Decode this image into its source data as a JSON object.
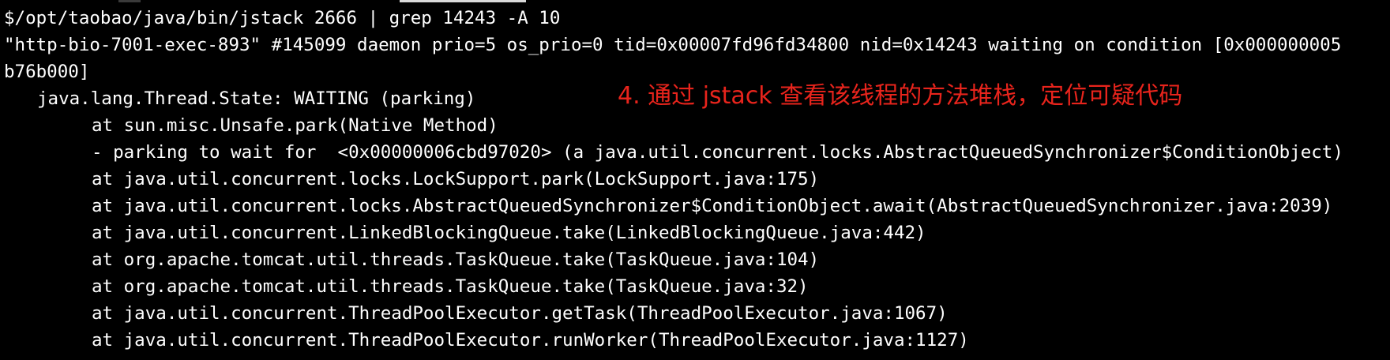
{
  "terminal": {
    "lines": [
      "$/opt/taobao/java/bin/jstack 2666 | grep 14243 -A 10",
      "\"http-bio-7001-exec-893\" #145099 daemon prio=5 os_prio=0 tid=0x00007fd96fd34800 nid=0x14243 waiting on condition [0x000000005",
      "b76b000]",
      "java.lang.Thread.State: WAITING (parking)",
      "at sun.misc.Unsafe.park(Native Method)",
      "- parking to wait for  <0x00000006cbd97020> (a java.util.concurrent.locks.AbstractQueuedSynchronizer$ConditionObject)",
      "at java.util.concurrent.locks.LockSupport.park(LockSupport.java:175)",
      "at java.util.concurrent.locks.AbstractQueuedSynchronizer$ConditionObject.await(AbstractQueuedSynchronizer.java:2039)",
      "at java.util.concurrent.LinkedBlockingQueue.take(LinkedBlockingQueue.java:442)",
      "at org.apache.tomcat.util.threads.TaskQueue.take(TaskQueue.java:104)",
      "at org.apache.tomcat.util.threads.TaskQueue.take(TaskQueue.java:32)",
      "at java.util.concurrent.ThreadPoolExecutor.getTask(ThreadPoolExecutor.java:1067)",
      "at java.util.concurrent.ThreadPoolExecutor.runWorker(ThreadPoolExecutor.java:1127)"
    ],
    "annotation": "4. 通过 jstack 查看该线程的方法堆栈，定位可疑代码"
  },
  "colors": {
    "background": "#000000",
    "text": "#ffffff",
    "annotation": "#e8241c"
  }
}
